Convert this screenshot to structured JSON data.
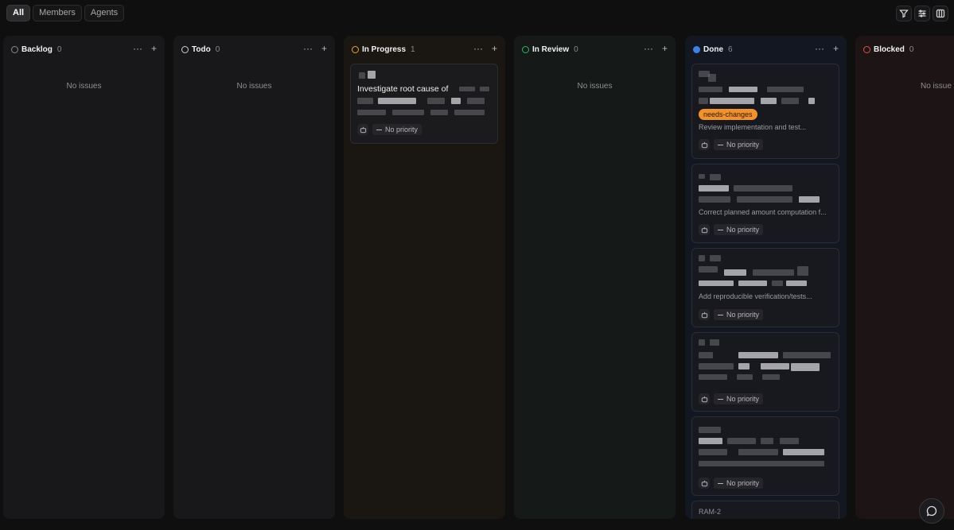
{
  "filters": {
    "tabs": [
      "All",
      "Members",
      "Agents"
    ],
    "active": "All"
  },
  "toolbar": {
    "icons": [
      "filter-icon",
      "display-settings-icon",
      "board-view-icon"
    ]
  },
  "columns": [
    {
      "title": "Backlog",
      "count": "0",
      "status_color": "#8a8a8f",
      "empty_text": "No issues"
    },
    {
      "title": "Todo",
      "count": "0",
      "status_color": "#d0d0d4",
      "empty_text": "No issues"
    },
    {
      "title": "In Progress",
      "count": "1",
      "status_color": "#e9a23b"
    },
    {
      "title": "In Review",
      "count": "0",
      "status_color": "#2fb36d",
      "empty_text": "No issues"
    },
    {
      "title": "Done",
      "count": "6",
      "status_color": "#3f7fe8"
    },
    {
      "title": "Blocked",
      "count": "0",
      "status_color": "#e0504d",
      "empty_text": "No issue"
    }
  ],
  "cards": {
    "in_progress": [
      {
        "title": "Investigate root cause of",
        "priority": "No priority"
      }
    ],
    "done": [
      {
        "label": "needs-changes",
        "description": "Review implementation and test...",
        "priority": "No priority"
      },
      {
        "description": "Correct planned amount computation f...",
        "priority": "No priority"
      },
      {
        "description": "Add reproducible verification/tests...",
        "priority": "No priority"
      },
      {
        "priority": "No priority"
      },
      {
        "priority": "No priority"
      },
      {
        "id": "RAM-2"
      }
    ]
  },
  "colors": {
    "label_bg": "#f2922b"
  }
}
